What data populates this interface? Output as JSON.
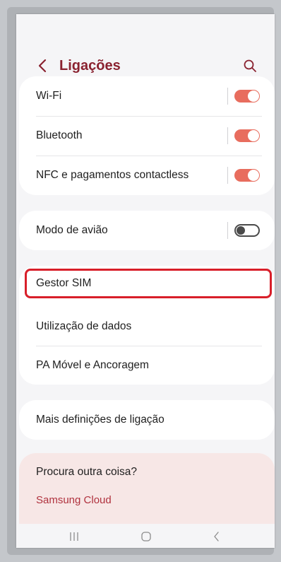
{
  "header": {
    "title": "Ligações",
    "back_icon": "chevron-left-icon",
    "search_icon": "search-icon"
  },
  "connectivity": [
    {
      "label": "Wi-Fi",
      "toggle": "on"
    },
    {
      "label": "Bluetooth",
      "toggle": "on"
    },
    {
      "label": "NFC e pagamentos contactless",
      "toggle": "on"
    }
  ],
  "airplane": {
    "label": "Modo de avião",
    "toggle": "off"
  },
  "network": [
    {
      "label": "Gestor SIM",
      "highlighted": true
    },
    {
      "label": "Utilização de dados"
    },
    {
      "label": "PA Móvel e Ancoragem"
    }
  ],
  "more": {
    "label": "Mais definições de ligação"
  },
  "suggestions": {
    "title": "Procura outra coisa?",
    "link": "Samsung Cloud"
  },
  "navbar": {
    "recents_icon": "recents-icon",
    "home_icon": "home-icon",
    "back_icon": "back-icon"
  },
  "colors": {
    "accent": "#8a2230",
    "toggle_on": "#e86d5e",
    "highlight": "#d81f2a",
    "suggestion_bg": "#f7e7e6"
  }
}
